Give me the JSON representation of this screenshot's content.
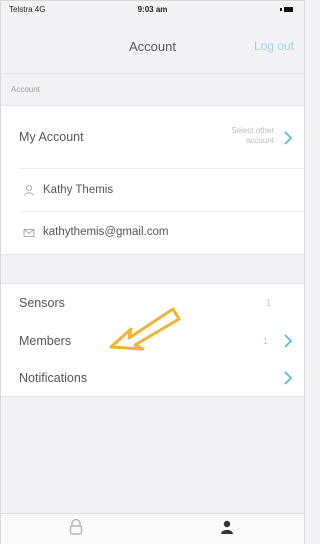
{
  "status_bar": {
    "carrier": "Telstra  4G",
    "time": "9:03 am",
    "battery_level": 0.85
  },
  "nav": {
    "title": "Account",
    "logout": "Log out"
  },
  "section_header": "Account",
  "account_card": {
    "my_account_label": "My Account",
    "select_other_line1": "Select other",
    "select_other_line2": "account",
    "name": "Kathy Themis",
    "email": "kathythemis@gmail.com"
  },
  "settings_card": {
    "sensors_label": "Sensors",
    "sensors_count": "1",
    "members_label": "Members",
    "members_count": "1",
    "notifications_label": "Notifications"
  },
  "tab_bar": {
    "tabs": [
      {
        "label": "",
        "icon": "lock-icon",
        "active": false
      },
      {
        "label": "",
        "icon": "person-icon",
        "active": true
      }
    ]
  },
  "colors": {
    "accent": "#5bb8e6",
    "arrow": "#f2b233"
  }
}
